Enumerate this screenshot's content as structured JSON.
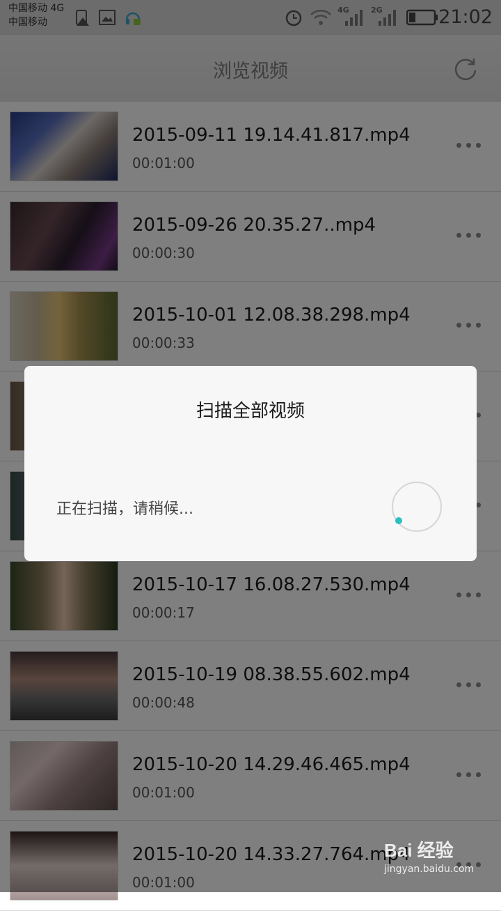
{
  "status_bar": {
    "carrier1": "中国移动 4G",
    "carrier2": "中国移动",
    "net1": "4G",
    "net2": "2G",
    "time": "21:02"
  },
  "header": {
    "title": "浏览视频"
  },
  "videos": [
    {
      "title": "2015-09-11 19.14.41.817.mp4",
      "duration": "00:01:00"
    },
    {
      "title": "2015-09-26 20.35.27..mp4",
      "duration": "00:00:30"
    },
    {
      "title": "2015-10-01 12.08.38.298.mp4",
      "duration": "00:00:33"
    },
    {
      "title": "",
      "duration": ""
    },
    {
      "title": "",
      "duration": ""
    },
    {
      "title": "2015-10-17 16.08.27.530.mp4",
      "duration": "00:00:17"
    },
    {
      "title": "2015-10-19 08.38.55.602.mp4",
      "duration": "00:00:48"
    },
    {
      "title": "2015-10-20 14.29.46.465.mp4",
      "duration": "00:01:00"
    },
    {
      "title": "2015-10-20 14.33.27.764.mp4",
      "duration": "00:01:00"
    }
  ],
  "dialog": {
    "title": "扫描全部视频",
    "message": "正在扫描，请稍候..."
  },
  "watermark": {
    "logo": "Bai 经验",
    "url": "jingyan.baidu.com"
  },
  "colors": {
    "spinner_accent": "#2bbfc0",
    "overlay": "#000000"
  }
}
